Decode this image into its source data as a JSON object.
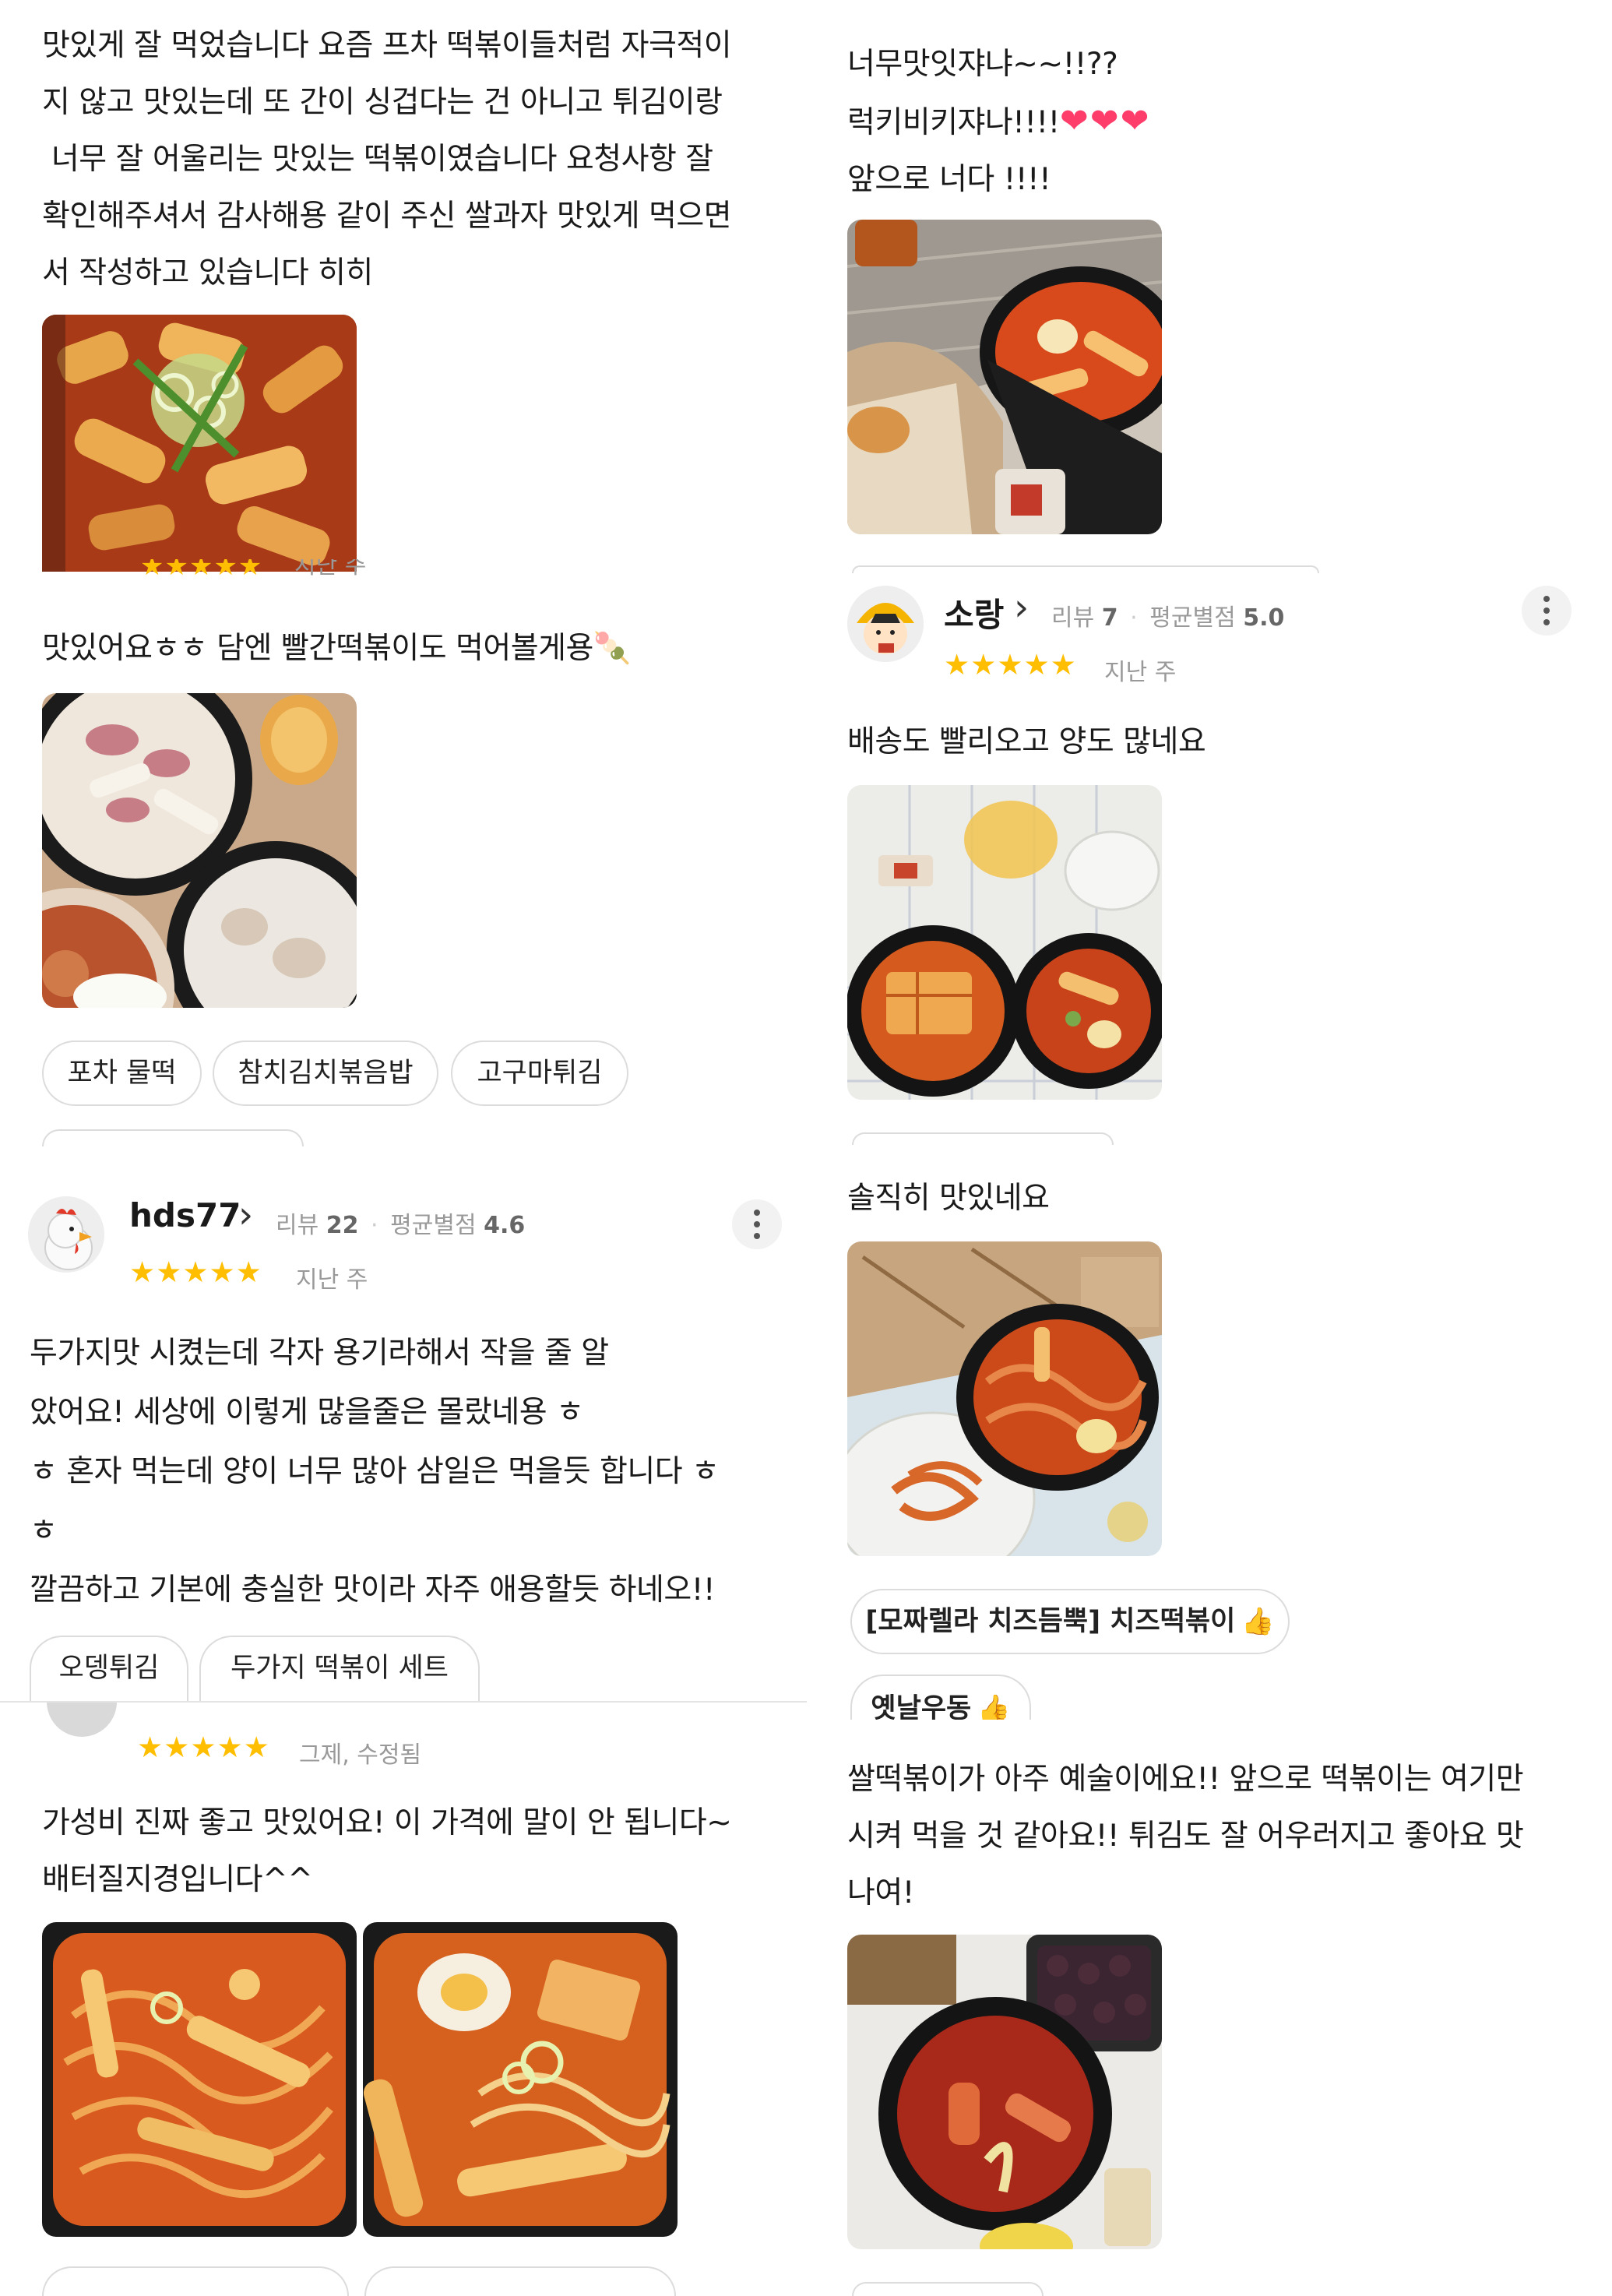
{
  "left": {
    "review1": {
      "lines": [
        "맛있게 잘 먹었습니다 요즘 프차 떡볶이들처럼 자극적이",
        "지 않고 맛있는데 또 간이 싱겁다는 건 아니고 튀김이랑",
        " 너무 잘 어울리는 맛있는 떡볶이였습니다 요청사항 잘",
        "확인해주셔서 감사해용 같이 주신 쌀과자 맛있게 먹으면",
        "서 작성하고 있습니다 히히"
      ],
      "partial_when": "지난 주"
    },
    "review2": {
      "text": "맛있어요ㅎㅎ 담엔 빨간떡볶이도 먹어볼게용",
      "emoji": "🍡",
      "chips": [
        "포차 물떡",
        "참치김치볶음밥",
        "고구마튀김"
      ]
    },
    "review3": {
      "username": "hds77",
      "review_label": "리뷰",
      "review_count": "22",
      "avg_label": "평균별점",
      "avg_rating": "4.6",
      "stars": "★★★★★",
      "when": "지난 주",
      "lines": [
        "두가지맛 시켰는데 각자 용기라해서 작을 줄 알",
        "았어요! 세상에 이렇게 많을줄은 몰랐네용 ㅎ",
        "ㅎ 혼자 먹는데 양이 너무 많아 삼일은 먹을듯 합니다 ㅎ",
        "ㅎ",
        "깔끔하고 기본에 충실한 맛이라 자주 애용할듯 하네오!!"
      ],
      "chips": [
        "오뎅튀김",
        "두가지 떡볶이 세트"
      ]
    },
    "review4": {
      "stars": "★★★★★",
      "when": "그제, 수정됨",
      "lines": [
        "가성비 진짜 좋고 맛있어요! 이 가격에 말이 안 됩니다~",
        "배터질지경입니다^^"
      ]
    }
  },
  "right": {
    "review1": {
      "lines": [
        "너무맛잇쟈냐~~!!??",
        "럭키비키쟈나!!!!",
        "앞으로 너다 !!!!"
      ],
      "hearts": "❤❤❤"
    },
    "review2": {
      "username": "소랑",
      "review_label": "리뷰",
      "review_count": "7",
      "avg_label": "평균별점",
      "avg_rating": "5.0",
      "stars": "★★★★★",
      "when": "지난 주",
      "text": "배송도 빨리오고 양도 많네요"
    },
    "review3": {
      "text": "솔직히 맛있네요",
      "chips": [
        "[모짜렐라 치즈듬뿍] 치즈떡볶이",
        "옛날우동"
      ]
    },
    "review4": {
      "lines": [
        "쌀떡볶이가 아주 예술이에요!! 앞으로 떡볶이는 여기만",
        "시켜 먹을 것 같아요!! 튀김도 잘 어우러지고 좋아요 맛",
        "나여!"
      ]
    }
  },
  "icons": {
    "chevron": "›",
    "thumb": "👍",
    "separator": "·"
  },
  "colors": {
    "star": "#ffbe00",
    "chip_border": "#dcdcdc",
    "thumb_icon": "#1e8ce8",
    "meta_text": "#999999"
  }
}
